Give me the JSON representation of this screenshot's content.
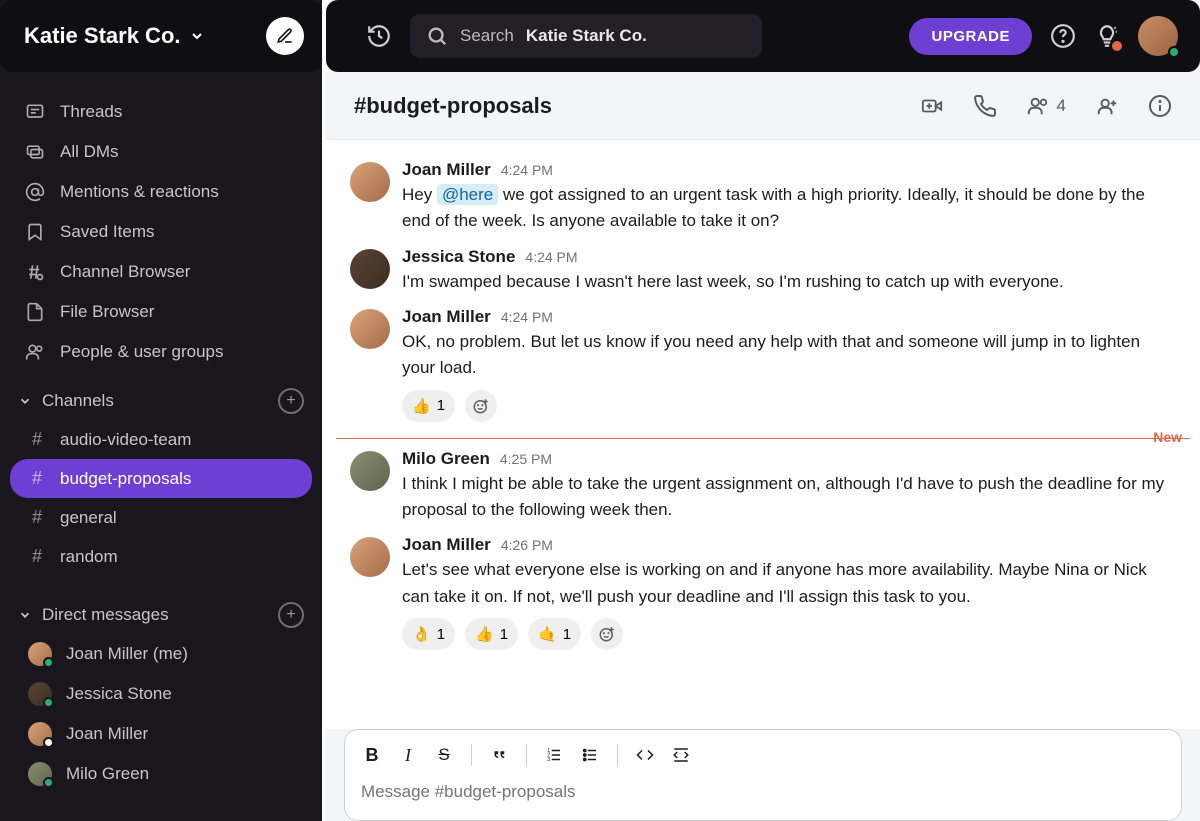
{
  "workspace": {
    "name": "Katie Stark Co."
  },
  "search": {
    "prefix": "Search",
    "scope": "Katie Stark Co."
  },
  "topbar": {
    "upgrade": "UPGRADE"
  },
  "nav": {
    "threads": "Threads",
    "all_dms": "All DMs",
    "mentions": "Mentions & reactions",
    "saved": "Saved Items",
    "channel_browser": "Channel Browser",
    "file_browser": "File Browser",
    "people": "People & user groups"
  },
  "sections": {
    "channels": "Channels",
    "dms": "Direct messages"
  },
  "channels": [
    {
      "name": "audio-video-team",
      "active": false
    },
    {
      "name": "budget-proposals",
      "active": true
    },
    {
      "name": "general",
      "active": false
    },
    {
      "name": "random",
      "active": false
    }
  ],
  "dms": [
    {
      "name": "Joan Miller (me)",
      "presence": "online",
      "avatar": "av-joan"
    },
    {
      "name": "Jessica Stone",
      "presence": "online",
      "avatar": "av-jess"
    },
    {
      "name": "Joan Miller",
      "presence": "away",
      "avatar": "av-joan"
    },
    {
      "name": "Milo Green",
      "presence": "online",
      "avatar": "av-milo"
    }
  ],
  "channel_header": {
    "title": "#budget-proposals",
    "member_count": "4"
  },
  "divider": {
    "label": "New"
  },
  "messages": [
    {
      "author": "Joan Miller",
      "time": "4:24 PM",
      "avatar": "av-joan",
      "text_pre": "Hey ",
      "mention": "@here",
      "text_post": " we got assigned to an urgent task with a high priority. Ideally, it should be done by the end of the week. Is anyone available to take it on?"
    },
    {
      "author": "Jessica Stone",
      "time": "4:24 PM",
      "avatar": "av-jess",
      "text": "I'm swamped because I wasn't here last week, so I'm rushing to catch up with everyone."
    },
    {
      "author": "Joan Miller",
      "time": "4:24 PM",
      "avatar": "av-joan",
      "text": "OK, no problem. But let us know if you need any help with that and someone will jump in to lighten your load.",
      "reactions": [
        {
          "emoji": "👍",
          "count": "1"
        }
      ],
      "add_reaction": true
    },
    {
      "divider": true
    },
    {
      "author": "Milo Green",
      "time": "4:25 PM",
      "avatar": "av-milo",
      "text": "I think I might be able to take the urgent assignment on, although I'd have to push the deadline for my proposal to the following week then."
    },
    {
      "author": "Joan Miller",
      "time": "4:26 PM",
      "avatar": "av-joan",
      "text": "Let's see what everyone else is working on and if anyone has more availability. Maybe Nina or Nick can take it on. If not, we'll push your deadline and I'll assign this task to you.",
      "reactions": [
        {
          "emoji": "👌",
          "count": "1"
        },
        {
          "emoji": "👍",
          "count": "1"
        },
        {
          "emoji": "🤙",
          "count": "1"
        }
      ],
      "add_reaction": true
    }
  ],
  "composer": {
    "placeholder": "Message #budget-proposals"
  }
}
